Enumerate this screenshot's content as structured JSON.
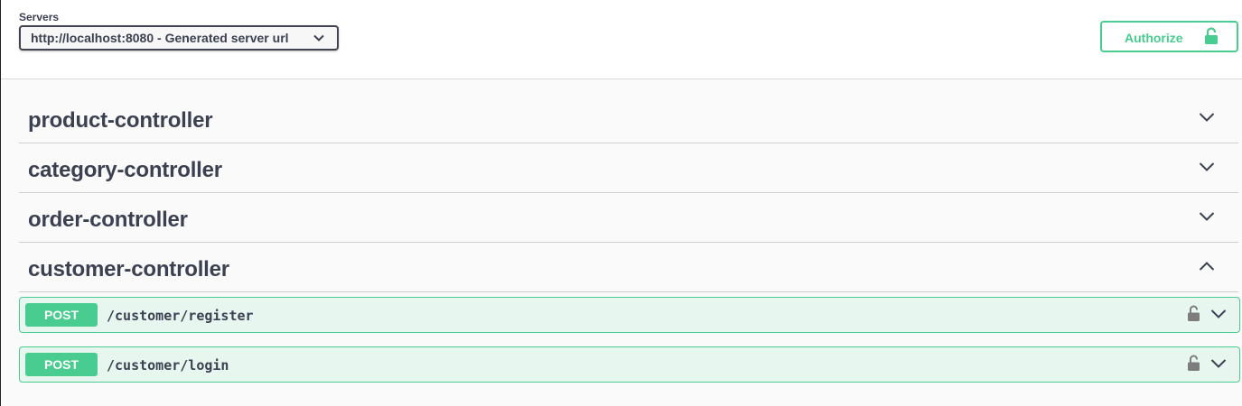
{
  "servers": {
    "label": "Servers",
    "selected": "http://localhost:8080 - Generated server url"
  },
  "authorize": {
    "label": "Authorize"
  },
  "tags": [
    {
      "name": "product-controller",
      "expanded": false
    },
    {
      "name": "category-controller",
      "expanded": false
    },
    {
      "name": "order-controller",
      "expanded": false
    },
    {
      "name": "customer-controller",
      "expanded": true
    }
  ],
  "operations": [
    {
      "method": "POST",
      "path": "/customer/register"
    },
    {
      "method": "POST",
      "path": "/customer/login"
    }
  ],
  "colors": {
    "post": "#49cc90",
    "post_bg": "#e8f6f0",
    "text": "#3b4151"
  },
  "icons": {
    "server_dropdown": "chevron-down-icon",
    "authorize": "unlock-icon",
    "operation_lock": "unlock-icon",
    "collapsed": "chevron-down-icon",
    "expanded": "chevron-up-icon"
  }
}
